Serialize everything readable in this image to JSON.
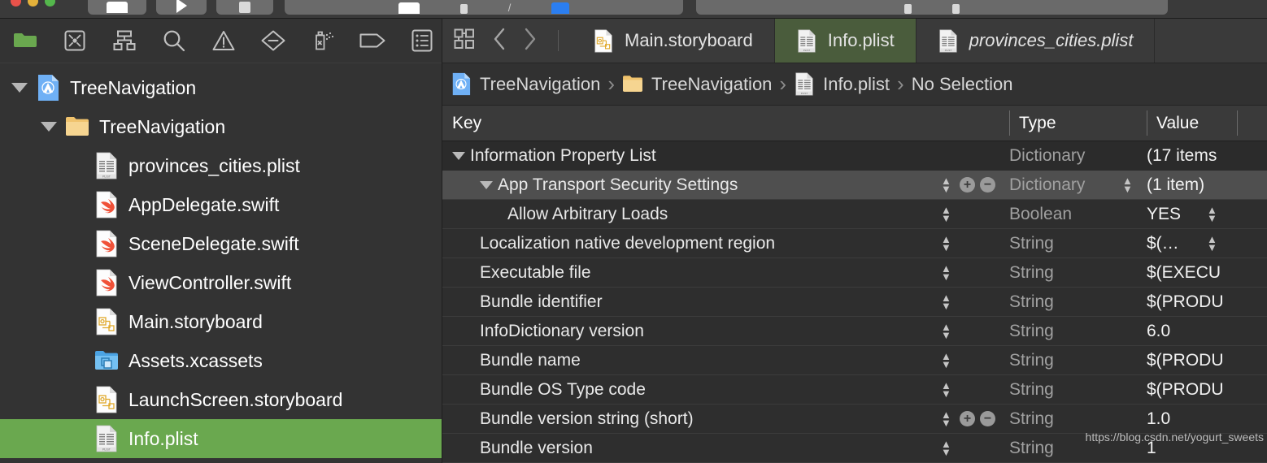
{
  "window": {
    "traffic_lights": [
      "close",
      "minimize",
      "zoom"
    ],
    "toolbar_buttons": [
      "toggle-navigator",
      "run",
      "stop"
    ],
    "toolbar_fields": [
      "scheme-selector",
      "activity-view"
    ]
  },
  "navigator": {
    "filter_icons": [
      "folder-icon",
      "source-control-icon",
      "symbol-hierarchy-icon",
      "search-icon",
      "issue-warning-icon",
      "test-diamond-icon",
      "debug-spray-icon",
      "breakpoint-tag-icon",
      "report-list-icon"
    ],
    "tree": [
      {
        "label": "TreeNavigation",
        "icon": "xcode-project-icon",
        "indent": 0,
        "disclosure": "open",
        "selected": false
      },
      {
        "label": "TreeNavigation",
        "icon": "folder-icon",
        "indent": 1,
        "disclosure": "open",
        "selected": false
      },
      {
        "label": "provinces_cities.plist",
        "icon": "plist-file-icon",
        "indent": 2,
        "disclosure": "none",
        "selected": false
      },
      {
        "label": "AppDelegate.swift",
        "icon": "swift-file-icon",
        "indent": 2,
        "disclosure": "none",
        "selected": false
      },
      {
        "label": "SceneDelegate.swift",
        "icon": "swift-file-icon",
        "indent": 2,
        "disclosure": "none",
        "selected": false
      },
      {
        "label": "ViewController.swift",
        "icon": "swift-file-icon",
        "indent": 2,
        "disclosure": "none",
        "selected": false
      },
      {
        "label": "Main.storyboard",
        "icon": "storyboard-file-icon",
        "indent": 2,
        "disclosure": "none",
        "selected": false
      },
      {
        "label": "Assets.xcassets",
        "icon": "assets-catalog-icon",
        "indent": 2,
        "disclosure": "none",
        "selected": false
      },
      {
        "label": "LaunchScreen.storyboard",
        "icon": "storyboard-file-icon",
        "indent": 2,
        "disclosure": "none",
        "selected": false
      },
      {
        "label": "Info.plist",
        "icon": "plist-file-icon",
        "indent": 2,
        "disclosure": "none",
        "selected": true
      }
    ]
  },
  "editor": {
    "controls": [
      "editor-options-icon",
      "back-chevron-icon",
      "forward-chevron-icon"
    ],
    "tabs": [
      {
        "label": "Main.storyboard",
        "icon": "storyboard-file-icon",
        "active": false,
        "italic": false
      },
      {
        "label": "Info.plist",
        "icon": "plist-file-icon",
        "active": true,
        "italic": false
      },
      {
        "label": "provinces_cities.plist",
        "icon": "plist-file-icon",
        "active": false,
        "italic": true
      }
    ],
    "breadcrumb": [
      {
        "label": "TreeNavigation",
        "icon": "xcode-project-icon"
      },
      {
        "label": "TreeNavigation",
        "icon": "folder-icon"
      },
      {
        "label": "Info.plist",
        "icon": "plist-file-icon"
      },
      {
        "label": "No Selection",
        "icon": "none"
      }
    ],
    "breadcrumb_separator": "›"
  },
  "plist_table": {
    "columns": [
      "Key",
      "Type",
      "Value"
    ],
    "rows": [
      {
        "key": "Information Property List",
        "type": "Dictionary",
        "value": "(17 items",
        "indent": 0,
        "disclosure": "open",
        "selected": false,
        "steppers": [],
        "plusminus": false
      },
      {
        "key": "App Transport Security Settings",
        "type": "Dictionary",
        "value": "(1 item)",
        "indent": 1,
        "disclosure": "open",
        "selected": true,
        "steppers": [
          "key",
          "value"
        ],
        "plusminus": true
      },
      {
        "key": "Allow Arbitrary Loads",
        "type": "Boolean",
        "value": "YES",
        "indent": 2,
        "disclosure": "none",
        "selected": false,
        "steppers": [
          "key",
          "after-value"
        ],
        "plusminus": false
      },
      {
        "key": "Localization native development region",
        "type": "String",
        "value": "$(…",
        "indent": 1,
        "disclosure": "none",
        "selected": false,
        "steppers": [
          "key",
          "after-value"
        ],
        "plusminus": false
      },
      {
        "key": "Executable file",
        "type": "String",
        "value": "$(EXECU",
        "indent": 1,
        "disclosure": "none",
        "selected": false,
        "steppers": [
          "key"
        ],
        "plusminus": false
      },
      {
        "key": "Bundle identifier",
        "type": "String",
        "value": "$(PRODU",
        "indent": 1,
        "disclosure": "none",
        "selected": false,
        "steppers": [
          "key"
        ],
        "plusminus": false
      },
      {
        "key": "InfoDictionary version",
        "type": "String",
        "value": "6.0",
        "indent": 1,
        "disclosure": "none",
        "selected": false,
        "steppers": [
          "key"
        ],
        "plusminus": false
      },
      {
        "key": "Bundle name",
        "type": "String",
        "value": "$(PRODU",
        "indent": 1,
        "disclosure": "none",
        "selected": false,
        "steppers": [
          "key"
        ],
        "plusminus": false
      },
      {
        "key": "Bundle OS Type code",
        "type": "String",
        "value": "$(PRODU",
        "indent": 1,
        "disclosure": "none",
        "selected": false,
        "steppers": [
          "key"
        ],
        "plusminus": false
      },
      {
        "key": "Bundle version string (short)",
        "type": "String",
        "value": "1.0",
        "indent": 1,
        "disclosure": "none",
        "selected": false,
        "steppers": [
          "key"
        ],
        "plusminus": true
      },
      {
        "key": "Bundle version",
        "type": "String",
        "value": "1",
        "indent": 1,
        "disclosure": "none",
        "selected": false,
        "steppers": [
          "key"
        ],
        "plusminus": false
      }
    ]
  },
  "watermark": {
    "text": "https://blog.csdn.net/yogurt_sweets"
  },
  "colors": {
    "selection_green": "#6aa84f",
    "tab_active_green": "#4a5c3c",
    "row_selected": "#4f4f4f",
    "background": "#333333",
    "editor_background": "#2e2e2e"
  }
}
